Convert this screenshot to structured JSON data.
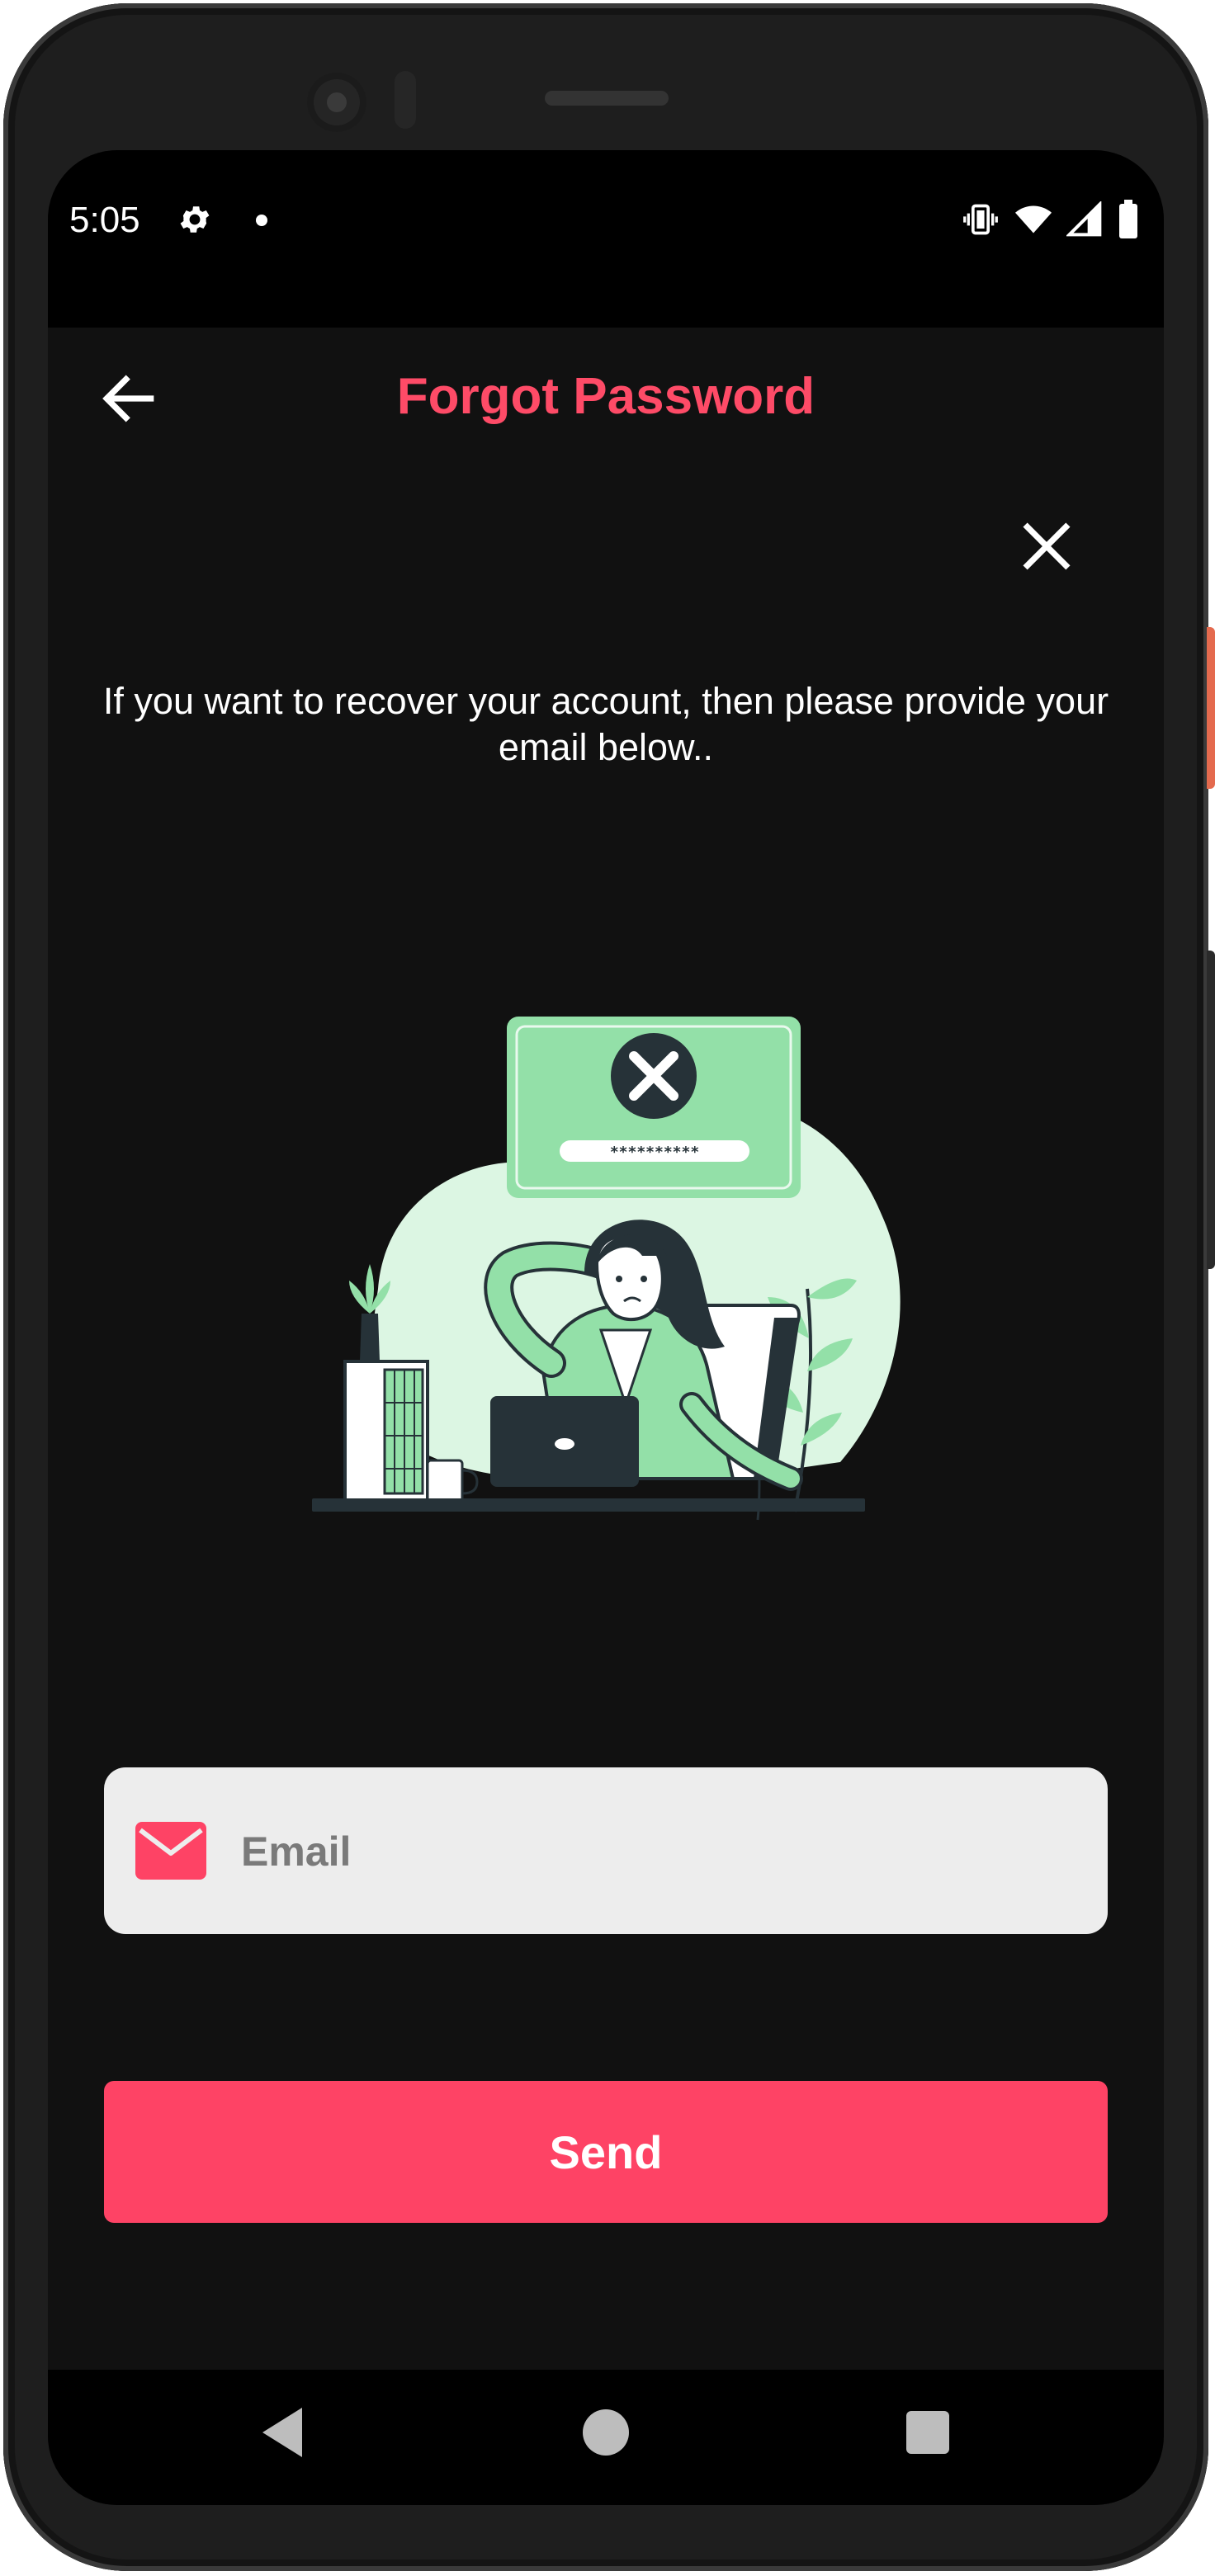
{
  "status_bar": {
    "time": "5:05"
  },
  "app_bar": {
    "title": "Forgot Password"
  },
  "content": {
    "prompt": "If you want to recover your account, then please provide your email below..",
    "illustration_password_mask": "**********"
  },
  "form": {
    "email_placeholder": "Email",
    "email_value": "",
    "send_label": "Send"
  },
  "colors": {
    "accent": "#fe4365",
    "background": "#111111",
    "field_bg": "#ededed",
    "illustration_green": "#93e0a8"
  },
  "icons": {
    "back": "arrow-left-icon",
    "close": "close-icon",
    "email": "envelope-icon",
    "settings": "gear-icon",
    "vibrate": "vibrate-icon",
    "wifi": "wifi-icon",
    "signal": "signal-icon",
    "battery": "battery-icon"
  }
}
